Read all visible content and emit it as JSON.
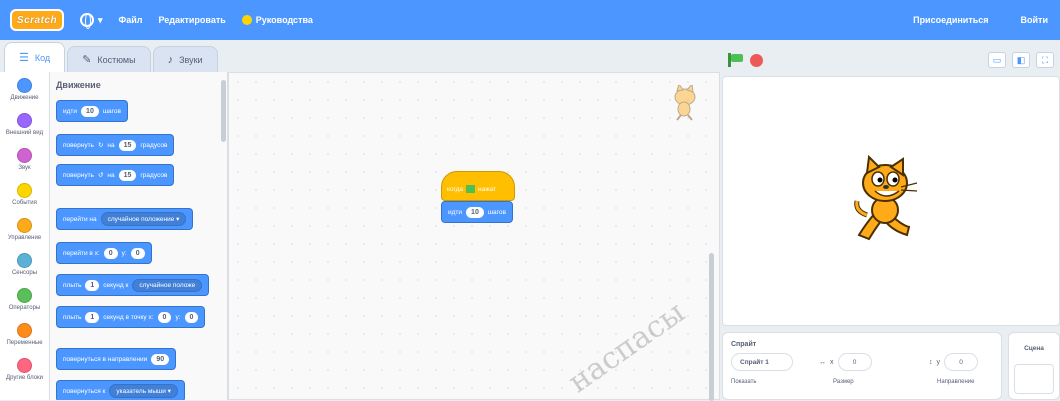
{
  "menu": {
    "logo": "Scratch",
    "file": "Файл",
    "edit": "Редактировать",
    "tutorials": "Руководства",
    "join": "Присоединиться",
    "signin": "Войти"
  },
  "tabs": [
    {
      "label": "Код",
      "icon": "code-icon"
    },
    {
      "label": "Костюмы",
      "icon": "brush-icon"
    },
    {
      "label": "Звуки",
      "icon": "speaker-icon"
    }
  ],
  "categories": [
    {
      "label": "Движение",
      "color": "#4c97ff"
    },
    {
      "label": "Внешний вид",
      "color": "#9966ff"
    },
    {
      "label": "Звук",
      "color": "#cf63cf"
    },
    {
      "label": "События",
      "color": "#ffd500"
    },
    {
      "label": "Управление",
      "color": "#ffab19"
    },
    {
      "label": "Сенсоры",
      "color": "#5cb1d6"
    },
    {
      "label": "Операторы",
      "color": "#59c059"
    },
    {
      "label": "Переменные",
      "color": "#ff8c1a"
    },
    {
      "label": "Другие блоки",
      "color": "#ff6680"
    }
  ],
  "palette": {
    "title": "Движение",
    "blocks": {
      "move": {
        "pre": "идти",
        "value": "10",
        "post": "шагов"
      },
      "turn_right": {
        "pre": "повернуть",
        "arrow": "↻",
        "mid": "на",
        "value": "15",
        "post": "градусов"
      },
      "turn_left": {
        "pre": "повернуть",
        "arrow": "↺",
        "mid": "на",
        "value": "15",
        "post": "градусов"
      },
      "goto": {
        "pre": "перейти на",
        "option": "случайное положение ▾"
      },
      "goto_xy": {
        "pre": "перейти в x:",
        "x": "0",
        "ylabel": "y:",
        "y": "0"
      },
      "glide": {
        "pre": "плыть",
        "value": "1",
        "mid": "секунд к",
        "option": "случайное положе"
      },
      "glide_xy": {
        "pre": "плыть",
        "value": "1",
        "mid": "секунд в точку x:",
        "x": "0",
        "ylabel": "y:",
        "y": "0"
      },
      "point_dir": {
        "pre": "повернуться в направлении",
        "value": "90"
      },
      "point_towards": {
        "pre": "повернуться к",
        "option": "указатель мыши ▾"
      }
    }
  },
  "script": {
    "hat": {
      "pre": "когда",
      "post": "нажат"
    },
    "move": {
      "pre": "идти",
      "value": "10",
      "post": "шагов"
    }
  },
  "watermark": "наспасы",
  "sprite_pane": {
    "title": "Спрайт",
    "name": "Спрайт 1",
    "x_label": "x",
    "x": "0",
    "y_label": "y",
    "y": "0",
    "show_label": "Показать",
    "size_label": "Размер",
    "direction_label": "Направление"
  },
  "scene_pane": {
    "title": "Сцена"
  }
}
